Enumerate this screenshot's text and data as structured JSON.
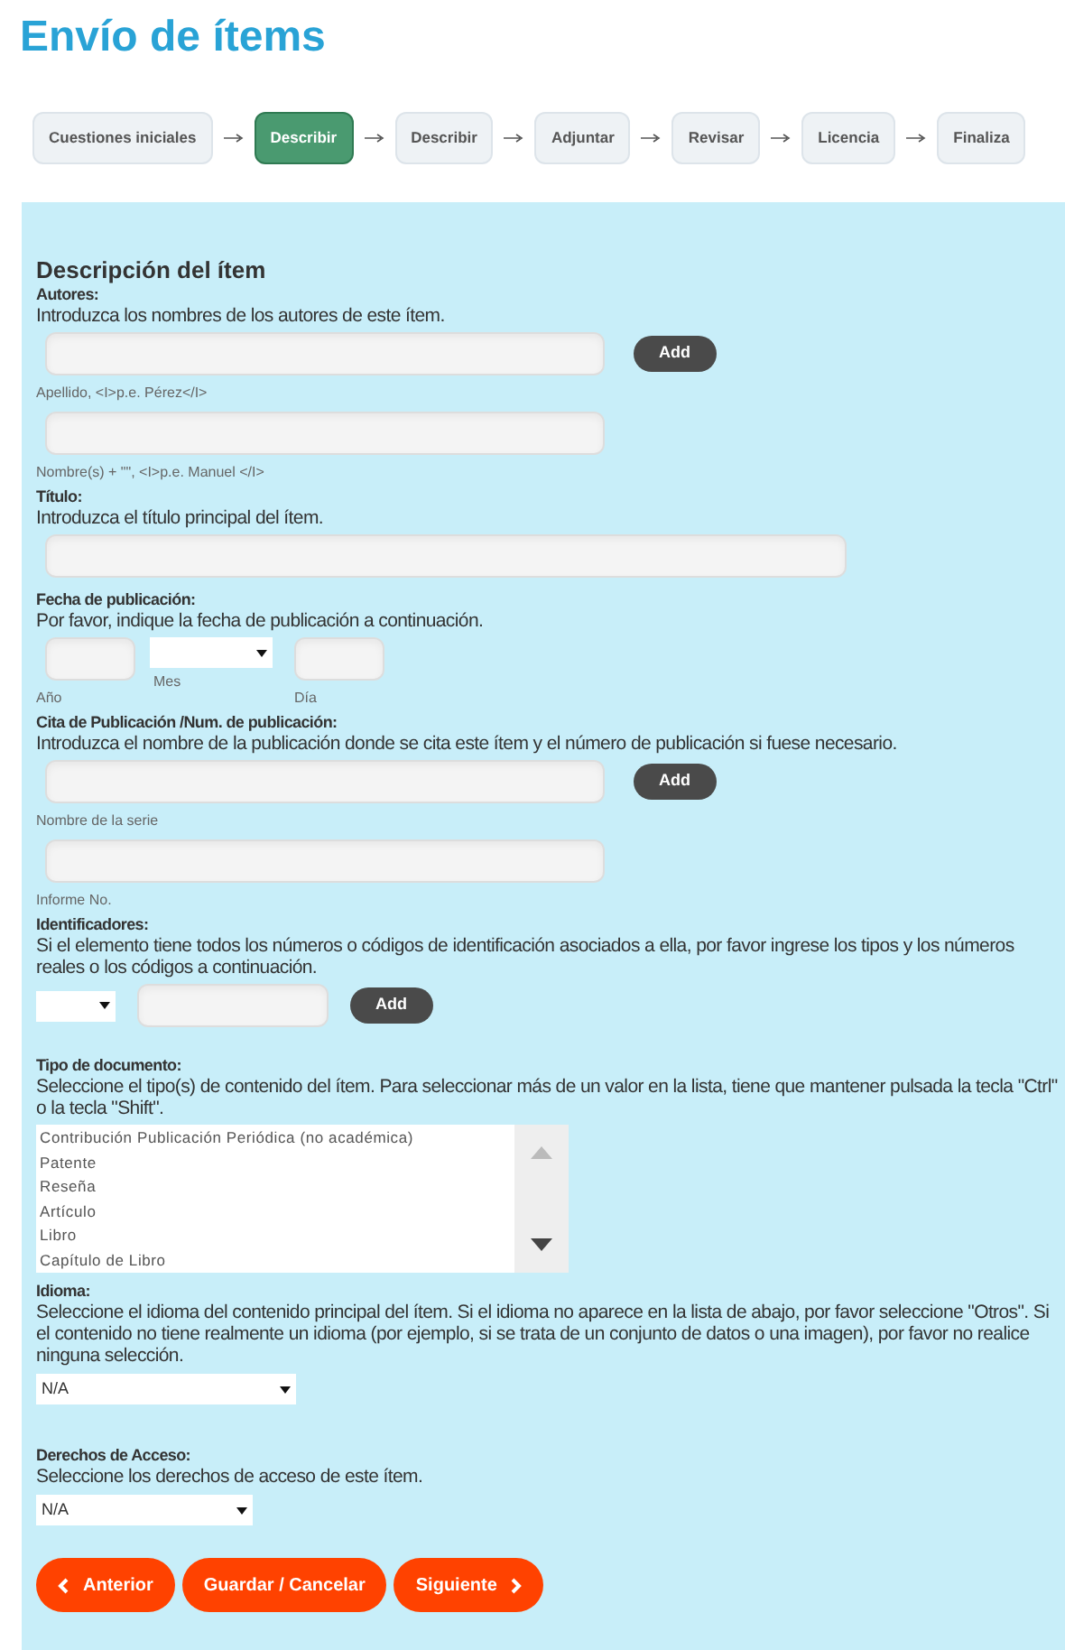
{
  "title": "Envío de ítems",
  "steps": [
    {
      "label": "Cuestiones iniciales",
      "selected": false
    },
    {
      "label": "Describir",
      "selected": true
    },
    {
      "label": "Describir",
      "selected": false
    },
    {
      "label": "Adjuntar",
      "selected": false
    },
    {
      "label": "Revisar",
      "selected": false
    },
    {
      "label": "Licencia",
      "selected": false
    },
    {
      "label": "Finaliza",
      "selected": false
    }
  ],
  "form": {
    "heading": "Descripción del ítem",
    "fields": [
      {
        "kind": "name",
        "label": "Autores:",
        "hint": "Introduzca los nombres de los autores de este ítem.",
        "button": "Add",
        "captions": [
          "Apellido, <I>p.e. Pérez</I>",
          "Nombre(s) + \"\", <I>p.e. Manuel </I>"
        ]
      },
      {
        "kind": "text",
        "label": "Título:",
        "hint": "Introduzca el título principal del ítem."
      },
      {
        "kind": "date",
        "label": "Fecha de publicación:",
        "hint": "Por favor, indique la fecha de publicación a continuación.",
        "captions": [
          "Año",
          "Mes",
          "Día"
        ]
      },
      {
        "kind": "series",
        "label": "Cita de Publicación /Num. de publicación:",
        "hint": "Introduzca el nombre de la publicación donde se cita este ítem y el número de publicación si fuese necesario.",
        "button": "Add",
        "captions": [
          "Nombre de la serie",
          "Informe No."
        ]
      },
      {
        "kind": "identifier",
        "label": "Identificadores:",
        "hint": "Si el elemento tiene todos los números o códigos de identificación asociados a ella, por favor ingrese los tipos y los números reales o los códigos a continuación.",
        "button": "Add"
      },
      {
        "kind": "list",
        "label": "Tipo de documento:",
        "hint": "Seleccione el tipo(s) de contenido del ítem. Para seleccionar más de un valor en la lista, tiene que mantener pulsada la tecla \"Ctrl\" o la tecla \"Shift\".",
        "options": [
          "Contribución Publicación Periódica (no académica)",
          "Patente",
          "Reseña",
          "Artículo",
          "Libro",
          "Capítulo de Libro"
        ]
      },
      {
        "kind": "select",
        "label": "Idioma:",
        "hint": "Seleccione el idioma del contenido principal del ítem. Si el idioma no aparece en la lista de abajo, por favor seleccione \"Otros\". Si el contenido no tiene realmente un idioma (por ejemplo, si se trata de un conjunto de datos o una imagen), por favor no realice ninguna selección.",
        "value": "N/A",
        "wide": true
      },
      {
        "kind": "select",
        "label": "Derechos de Acceso:",
        "hint": "Seleccione los derechos de acceso de este ítem.",
        "value": "N/A",
        "wide": false
      }
    ]
  },
  "buttons": [
    {
      "label": "Anterior",
      "kind": "prev"
    },
    {
      "label": "Guardar / Cancelar",
      "kind": "plain"
    },
    {
      "label": "Siguiente",
      "kind": "next"
    }
  ]
}
